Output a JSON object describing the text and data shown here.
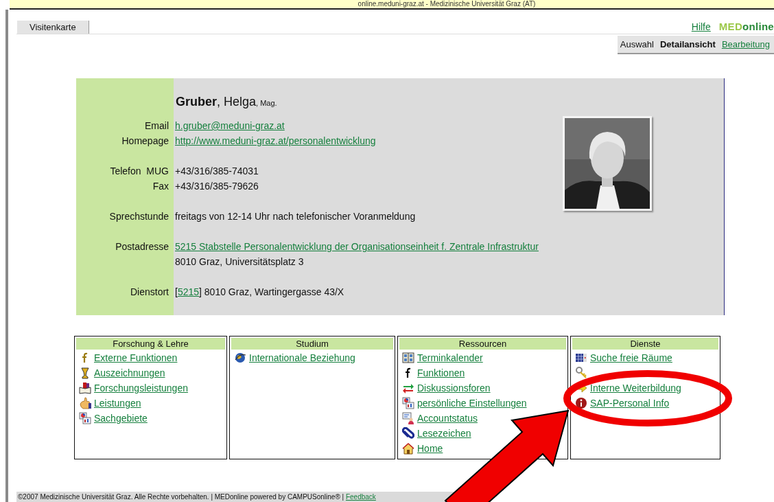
{
  "browser_title": "online.meduni-graz.at  -  Medizinische Universität Graz (AT)",
  "tabs": [
    {
      "label": "Visitenkarte",
      "selected": true
    }
  ],
  "help_link": "Hilfe",
  "logo": {
    "first": "MED",
    "second": "online"
  },
  "view_tabs": [
    {
      "label": "Auswahl",
      "selected": false,
      "kind": "plain"
    },
    {
      "label": "Detailansicht",
      "selected": true,
      "kind": "plain"
    },
    {
      "label": "Bearbeitung",
      "selected": false,
      "kind": "link"
    }
  ],
  "person": {
    "name": "**Gruber**, Helga",
    "title": ", Mag."
  },
  "field_groups": [
    [
      {
        "label": "Email",
        "lines": [
          [
            {
              "text": "h.gruber@meduni-graz.at",
              "link": true
            }
          ]
        ]
      },
      {
        "label": "Homepage",
        "lines": [
          [
            {
              "text": "http://www.meduni-graz.at/personalentwicklung",
              "link": true
            }
          ]
        ]
      }
    ],
    [
      {
        "label": "Telefon  MUG",
        "lines": [
          [
            {
              "text": "+43/316/385-74031",
              "link": false
            }
          ]
        ]
      },
      {
        "label": "Fax",
        "lines": [
          [
            {
              "text": "+43/316/385-79626",
              "link": false
            }
          ]
        ]
      }
    ],
    [
      {
        "label": "Sprechstunde",
        "lines": [
          [
            {
              "text": "freitags von 12-14 Uhr nach telefonischer Voranmeldung",
              "link": false
            }
          ]
        ]
      }
    ],
    [
      {
        "label": "Postadresse",
        "lines": [
          [
            {
              "text": "5215 Stabstelle Personalentwicklung der Organisationseinheit f. Zentrale Infrastruktur",
              "link": true
            }
          ],
          [
            {
              "text": "8010 Graz, Universitätsplatz 3",
              "link": false
            }
          ]
        ]
      }
    ],
    [
      {
        "label": "Dienstort",
        "lines": [
          [
            {
              "text": "[",
              "link": false
            },
            {
              "text": "5215",
              "link": true
            },
            {
              "text": "] 8010 Graz, Wartingergasse 43/X",
              "link": false
            }
          ]
        ]
      }
    ]
  ],
  "photo": {
    "kind": "picture"
  },
  "menus": [
    {
      "title": "Forschung & Lehre",
      "items": [
        {
          "label": "Externe Funktionen"
        },
        {
          "label": "Auszeichnungen"
        },
        {
          "label": "Forschungsleistungen"
        },
        {
          "label": "Leistungen"
        },
        {
          "label": "Sachgebiete"
        }
      ]
    },
    {
      "title": "Studium",
      "items": [
        {
          "label": "Internationale Beziehung"
        }
      ]
    },
    {
      "title": "Ressourcen",
      "items": [
        {
          "label": "Terminkalender"
        },
        {
          "label": "Funktionen"
        },
        {
          "label": "Diskussionsforen"
        },
        {
          "label": "persönliche Einstellungen"
        },
        {
          "label": "Accountstatus"
        },
        {
          "label": "Lesezeichen"
        },
        {
          "label": "Home"
        }
      ]
    },
    {
      "title": "Dienste",
      "items": [
        {
          "label": "Suche freie Räume",
          "kind": "link"
        },
        {
          "kind": "covered"
        },
        {
          "label": "Interne Weiterbildung",
          "kind": "link"
        },
        {
          "label": "SAP-Personal Info",
          "kind": "link"
        }
      ]
    }
  ],
  "footer": [
    {
      "text": "©2007 Medizinische Universität Graz. Alle Rechte vorbehalten. | MEDonline powered by CAMPUSonline® | ",
      "link": false
    },
    {
      "text": "Feedback",
      "link": true
    }
  ]
}
